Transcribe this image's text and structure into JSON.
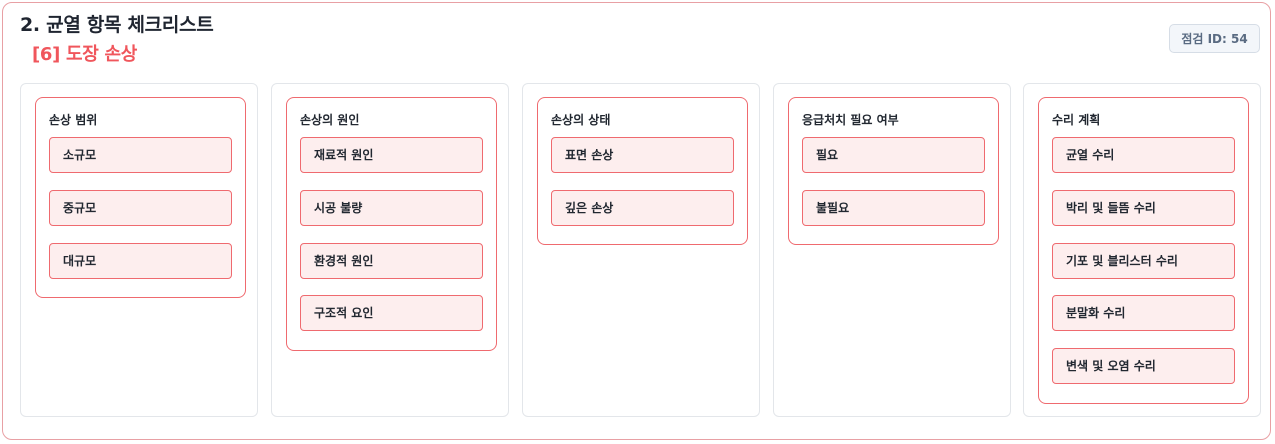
{
  "header": {
    "title": "2. 균열 항목 체크리스트",
    "subtitle": "[6] 도장 손상",
    "inspection_id": "점검 ID: 54"
  },
  "columns": [
    {
      "label": "손상 범위",
      "options": [
        "소규모",
        "중규모",
        "대규모"
      ]
    },
    {
      "label": "손상의 원인",
      "options": [
        "재료적 원인",
        "시공 불량",
        "환경적 원인",
        "구조적 요인"
      ]
    },
    {
      "label": "손상의 상태",
      "options": [
        "표면 손상",
        "깊은 손상"
      ]
    },
    {
      "label": "응급처치 필요 여부",
      "options": [
        "필요",
        "불필요"
      ]
    },
    {
      "label": "수리 계획",
      "options": [
        "균열 수리",
        "박리 및 들뜸 수리",
        "기포 및 블리스터 수리",
        "분말화 수리",
        "변색 및 오염 수리"
      ]
    }
  ],
  "colors": {
    "accent": "#f0565c",
    "border": "#ef6a6f",
    "option_bg": "#fdeeee"
  }
}
